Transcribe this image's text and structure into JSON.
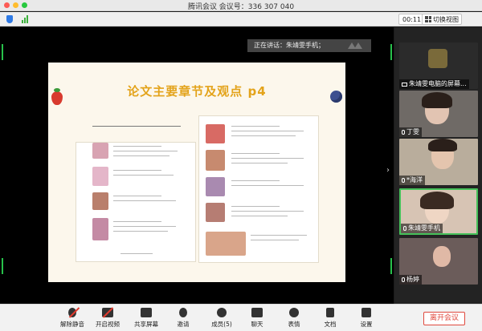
{
  "window": {
    "title": "腾讯会议 会议号：336 307 040"
  },
  "topbar": {
    "timer": "00:11",
    "switch_view": "切换视图"
  },
  "share": {
    "speaker_label": "正在讲话：朱靖雯手机；",
    "slide_title": "论文主要章节及观点  p4"
  },
  "participants": [
    {
      "name": "朱靖雯电脑的屏幕...",
      "muted": false,
      "active": false
    },
    {
      "name": "丁雯",
      "muted": false,
      "active": false
    },
    {
      "name": "*海洋",
      "muted": false,
      "active": false
    },
    {
      "name": "朱靖雯手机",
      "muted": false,
      "active": true
    },
    {
      "name": "杨婷",
      "muted": false,
      "active": false
    }
  ],
  "toolbar": {
    "items": [
      {
        "label": "解除静音",
        "icon": "mic-muted-icon"
      },
      {
        "label": "开启视频",
        "icon": "camera-off-icon"
      },
      {
        "label": "共享屏幕",
        "icon": "share-screen-icon"
      },
      {
        "label": "邀请",
        "icon": "invite-icon"
      },
      {
        "label": "成员(5)",
        "icon": "members-icon"
      },
      {
        "label": "聊天",
        "icon": "chat-icon"
      },
      {
        "label": "表情",
        "icon": "emoji-icon"
      },
      {
        "label": "文档",
        "icon": "document-icon"
      },
      {
        "label": "设置",
        "icon": "settings-icon"
      }
    ],
    "leave_label": "离开会议"
  },
  "colors": {
    "accent_green": "#27c04a",
    "leave_red": "#e0493e",
    "slide_title": "#e3a31a"
  }
}
